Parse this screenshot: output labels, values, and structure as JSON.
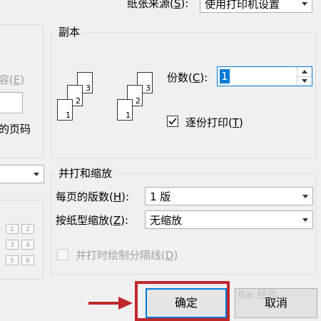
{
  "paper_source": {
    "label": "纸张来源",
    "hotkey": "S",
    "value": "使用打印机设置"
  },
  "left_panel": {
    "fragment_1": "容",
    "fragment_1_hotkey": "E",
    "fragment_2": "的页码"
  },
  "copies": {
    "group_title": "副本",
    "count_label": "份数",
    "count_hotkey": "C",
    "count_value": "1",
    "collate_label": "逐份打印",
    "collate_hotkey": "T",
    "collate_checked": true,
    "stack_a_numbers": [
      "1",
      "2",
      "3"
    ],
    "stack_b_numbers": [
      "1",
      "2",
      "3"
    ]
  },
  "zoom": {
    "group_title": "并打和缩放",
    "pages_per_sheet_label": "每页的版数",
    "pages_per_sheet_hotkey": "H",
    "pages_per_sheet_value": "1 版",
    "scale_label": "按纸型缩放",
    "scale_hotkey": "Z",
    "scale_value": "无缩放",
    "draw_borders_label": "并打时绘制分隔线",
    "draw_borders_hotkey": "D",
    "draw_borders_checked": false
  },
  "grid_preview": [
    "1",
    "2",
    "3",
    "4",
    "5",
    "6"
  ],
  "buttons": {
    "ok": "确定",
    "cancel": "取消"
  },
  "watermark": "Bai 经验",
  "colors": {
    "highlight_border": "#c0272d",
    "arrow": "#c0272d",
    "focus_border": "#0078d7",
    "selection": "#0078d7"
  }
}
